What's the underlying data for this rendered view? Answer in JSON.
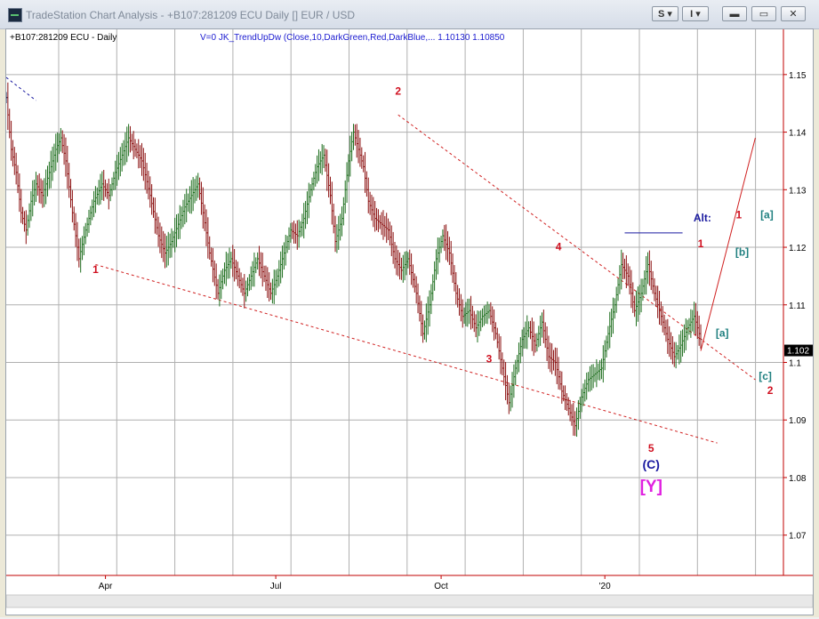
{
  "window": {
    "title": "TradeStation Chart Analysis - +B107:281209 ECU Daily [] EUR / USD",
    "buttons": {
      "s_label": "S",
      "i_label": "I"
    }
  },
  "chart_header": {
    "symbol_label": "+B107:281209 ECU - Daily",
    "indicator_label": "V=0  JK_TrendUpDw  (Close,10,DarkGreen,Red,DarkBlue,...  1.10130  1.10850"
  },
  "chart_data": {
    "type": "candlestick",
    "title": "",
    "ylim": [
      1.063,
      1.156
    ],
    "y_ticks": [
      "1.15",
      "1.14",
      "1.13",
      "1.12",
      "1.11",
      "1.1",
      "1.09",
      "1.08",
      "1.07"
    ],
    "x_ticks": [
      "Apr",
      "Jul",
      "Oct",
      "'20"
    ],
    "last_price_label": "1.102",
    "price_path": [
      [
        0,
        1.146
      ],
      [
        3,
        1.137
      ],
      [
        6,
        1.133
      ],
      [
        9,
        1.126
      ],
      [
        12,
        1.123
      ],
      [
        15,
        1.128
      ],
      [
        18,
        1.131
      ],
      [
        22,
        1.129
      ],
      [
        26,
        1.133
      ],
      [
        30,
        1.137
      ],
      [
        33,
        1.139
      ],
      [
        36,
        1.135
      ],
      [
        40,
        1.126
      ],
      [
        44,
        1.118
      ],
      [
        48,
        1.123
      ],
      [
        53,
        1.128
      ],
      [
        58,
        1.131
      ],
      [
        62,
        1.129
      ],
      [
        66,
        1.133
      ],
      [
        70,
        1.136
      ],
      [
        74,
        1.139
      ],
      [
        78,
        1.137
      ],
      [
        82,
        1.135
      ],
      [
        87,
        1.129
      ],
      [
        92,
        1.122
      ],
      [
        96,
        1.119
      ],
      [
        100,
        1.121
      ],
      [
        104,
        1.124
      ],
      [
        108,
        1.127
      ],
      [
        112,
        1.129
      ],
      [
        116,
        1.131
      ],
      [
        119,
        1.126
      ],
      [
        123,
        1.119
      ],
      [
        128,
        1.112
      ],
      [
        132,
        1.116
      ],
      [
        136,
        1.118
      ],
      [
        140,
        1.115
      ],
      [
        144,
        1.112
      ],
      [
        148,
        1.115
      ],
      [
        152,
        1.118
      ],
      [
        156,
        1.115
      ],
      [
        160,
        1.112
      ],
      [
        164,
        1.115
      ],
      [
        168,
        1.119
      ],
      [
        172,
        1.123
      ],
      [
        176,
        1.122
      ],
      [
        180,
        1.125
      ],
      [
        184,
        1.13
      ],
      [
        188,
        1.134
      ],
      [
        192,
        1.136
      ],
      [
        196,
        1.129
      ],
      [
        199,
        1.121
      ],
      [
        203,
        1.125
      ],
      [
        207,
        1.135
      ],
      [
        210,
        1.14
      ],
      [
        213,
        1.137
      ],
      [
        216,
        1.134
      ],
      [
        219,
        1.128
      ],
      [
        223,
        1.125
      ],
      [
        227,
        1.124
      ],
      [
        231,
        1.123
      ],
      [
        235,
        1.118
      ],
      [
        239,
        1.116
      ],
      [
        243,
        1.118
      ],
      [
        248,
        1.112
      ],
      [
        252,
        1.105
      ],
      [
        256,
        1.11
      ],
      [
        260,
        1.118
      ],
      [
        264,
        1.122
      ],
      [
        268,
        1.119
      ],
      [
        272,
        1.112
      ],
      [
        276,
        1.108
      ],
      [
        280,
        1.109
      ],
      [
        284,
        1.106
      ],
      [
        288,
        1.108
      ],
      [
        292,
        1.109
      ],
      [
        296,
        1.105
      ],
      [
        300,
        1.099
      ],
      [
        304,
        1.093
      ],
      [
        308,
        1.099
      ],
      [
        312,
        1.104
      ],
      [
        316,
        1.106
      ],
      [
        320,
        1.103
      ],
      [
        324,
        1.107
      ],
      [
        328,
        1.101
      ],
      [
        332,
        1.1
      ],
      [
        336,
        1.095
      ],
      [
        340,
        1.092
      ],
      [
        344,
        1.089
      ],
      [
        348,
        1.094
      ],
      [
        352,
        1.097
      ],
      [
        356,
        1.098
      ],
      [
        360,
        1.099
      ],
      [
        364,
        1.105
      ],
      [
        368,
        1.11
      ],
      [
        372,
        1.117
      ],
      [
        376,
        1.115
      ],
      [
        380,
        1.109
      ],
      [
        384,
        1.112
      ],
      [
        388,
        1.117
      ],
      [
        392,
        1.112
      ],
      [
        396,
        1.108
      ],
      [
        400,
        1.104
      ],
      [
        404,
        1.101
      ],
      [
        408,
        1.103
      ],
      [
        412,
        1.106
      ],
      [
        416,
        1.108
      ],
      [
        420,
        1.104
      ]
    ],
    "projection": [
      [
        420,
        1.102
      ],
      [
        453,
        1.139
      ]
    ],
    "lower_channel": [
      [
        54,
        1.117
      ],
      [
        430,
        1.086
      ]
    ],
    "upper_channel": [
      [
        237,
        1.143
      ],
      [
        453,
        1.097
      ]
    ],
    "alt_underline": [
      [
        374,
        1.1225
      ],
      [
        409,
        1.1225
      ]
    ],
    "wave_labels": [
      {
        "text": "1",
        "x": 54,
        "y": 1.1155,
        "color": "#d01020"
      },
      {
        "text": "2",
        "x": 237,
        "y": 1.1465,
        "color": "#d01020"
      },
      {
        "text": "3",
        "x": 292,
        "y": 1.1,
        "color": "#d01020"
      },
      {
        "text": "4",
        "x": 334,
        "y": 1.1195,
        "color": "#d01020"
      },
      {
        "text": "5",
        "x": 390,
        "y": 1.0845,
        "color": "#d01020"
      },
      {
        "text": "(C)",
        "x": 390,
        "y": 1.0815,
        "color": "#1a1aa0"
      },
      {
        "text": "[Y]",
        "x": 390,
        "y": 1.0775,
        "color": "#e020e0"
      },
      {
        "text": "1",
        "x": 420,
        "y": 1.12,
        "color": "#d01020"
      },
      {
        "text": "[b]",
        "x": 445,
        "y": 1.1185,
        "color": "#208080"
      },
      {
        "text": "[a]",
        "x": 433,
        "y": 1.1045,
        "color": "#208080"
      },
      {
        "text": "[c]",
        "x": 459,
        "y": 1.097,
        "color": "#208080"
      },
      {
        "text": "2",
        "x": 462,
        "y": 1.0945,
        "color": "#d01020"
      },
      {
        "text": "Alt:",
        "x": 421,
        "y": 1.1245,
        "color": "#1a1aa0"
      },
      {
        "text": "1",
        "x": 443,
        "y": 1.125,
        "color": "#d01020"
      },
      {
        "text": "[a]",
        "x": 460,
        "y": 1.125,
        "color": "#208080"
      }
    ]
  },
  "colors": {
    "bull": "#1e6e1e",
    "bear": "#8b1010",
    "neutral": "#101040",
    "guide": "#d02020"
  }
}
